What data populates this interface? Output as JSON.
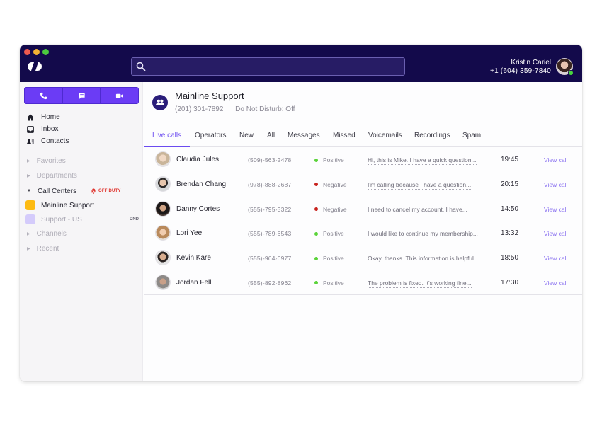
{
  "window": {
    "traffic_lights": [
      "close",
      "minimize",
      "maximize"
    ]
  },
  "topbar": {
    "logo": "dialpad-logo-icon",
    "search": {
      "placeholder": "",
      "value": "",
      "icon": "search-icon"
    },
    "user": {
      "name": "Kristin Cariel",
      "phone": "+1 (604) 359-7840",
      "status": "online",
      "status_color": "#48d43d"
    }
  },
  "sidebar": {
    "comm_buttons": [
      {
        "icon": "phone-icon",
        "label": "Call"
      },
      {
        "icon": "message-icon",
        "label": "Message"
      },
      {
        "icon": "video-icon",
        "label": "Video"
      }
    ],
    "nav": [
      {
        "icon": "home-icon",
        "label": "Home"
      },
      {
        "icon": "inbox-icon",
        "label": "Inbox"
      },
      {
        "icon": "contacts-icon",
        "label": "Contacts"
      }
    ],
    "sections": {
      "favorites": "Favorites",
      "departments": "Departments",
      "call_centers": "Call Centers",
      "channels": "Channels",
      "recent": "Recent"
    },
    "off_duty_label": "OFF DUTY",
    "call_centers": [
      {
        "label": "Mainline Support",
        "color": "#fdbb13",
        "badge": ""
      },
      {
        "label": "Support - US",
        "color": "#d4cbfb",
        "badge": "DND"
      }
    ]
  },
  "main": {
    "title": "Mainline Support",
    "phone": "(201) 301-7892",
    "dnd_status": "Do Not Disturb: Off",
    "tabs": [
      {
        "label": "Live calls",
        "active": true
      },
      {
        "label": "Operators",
        "active": false
      },
      {
        "label": "New",
        "active": false
      },
      {
        "label": "All",
        "active": false
      },
      {
        "label": "Messages",
        "active": false
      },
      {
        "label": "Missed",
        "active": false
      },
      {
        "label": "Voicemails",
        "active": false
      },
      {
        "label": "Recordings",
        "active": false
      },
      {
        "label": "Spam",
        "active": false
      }
    ],
    "calls": [
      {
        "name": "Claudia Jules",
        "phone": "(509)-563-2478",
        "sentiment": "Positive",
        "snippet": "Hi, this is Mike. I have a quick question...",
        "time": "19:45",
        "action": "View call"
      },
      {
        "name": "Brendan Chang",
        "phone": "(978)-888-2687",
        "sentiment": "Negative",
        "snippet": "I'm calling because I have a question...",
        "time": "20:15",
        "action": "View call"
      },
      {
        "name": "Danny Cortes",
        "phone": "(555)-795-3322",
        "sentiment": "Negative",
        "snippet": "I need to cancel my account. I have...",
        "time": "14:50",
        "action": "View call"
      },
      {
        "name": "Lori Yee",
        "phone": "(555)-789-6543",
        "sentiment": "Positive",
        "snippet": "I would like to continue my membership...",
        "time": "13:32",
        "action": "View call"
      },
      {
        "name": "Kevin Kare",
        "phone": "(555)-964-6977",
        "sentiment": "Positive",
        "snippet": "Okay, thanks. This information is helpful...",
        "time": "18:50",
        "action": "View call"
      },
      {
        "name": "Jordan Fell",
        "phone": "(555)-892-8962",
        "sentiment": "Positive",
        "snippet": "The problem is fixed. It's working fine...",
        "time": "17:30",
        "action": "View call"
      }
    ]
  },
  "colors": {
    "topbar": "#130a4b",
    "accent": "#6b3cf5",
    "positive": "#5bd33a",
    "negative": "#c8231e",
    "off_duty": "#e0322c"
  }
}
